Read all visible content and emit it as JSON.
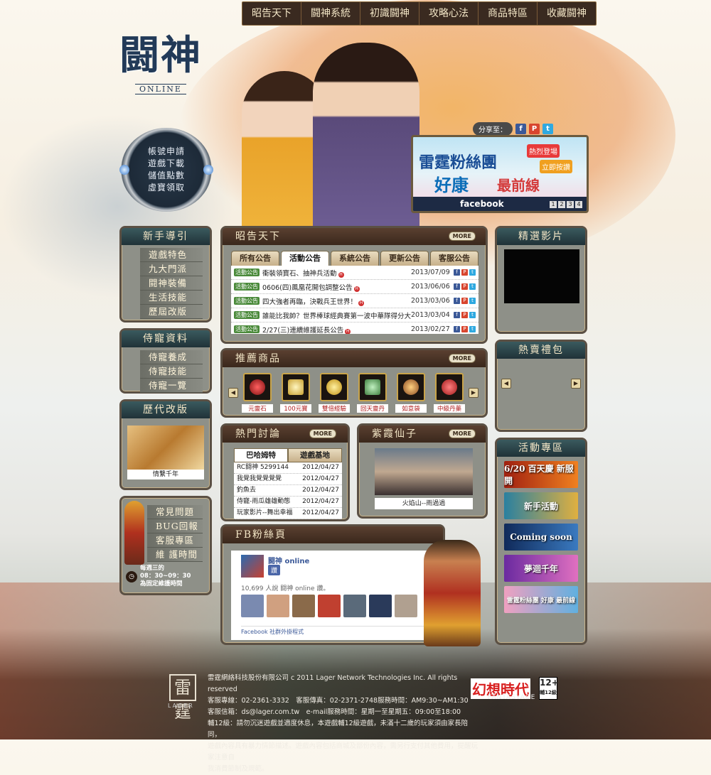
{
  "nav": [
    "昭告天下",
    "闘神系統",
    "初識闘神",
    "攻略心法",
    "商品特區",
    "收藏闘神"
  ],
  "logo": {
    "title": "闘神",
    "sub": "ONLINE"
  },
  "circle_menu": [
    "帳號申請",
    "遊戲下載",
    "儲值點數",
    "虛寶領取"
  ],
  "share": {
    "label": "分享至："
  },
  "fb_banner": {
    "line1": "雷霆粉絲團",
    "line2": "好康",
    "line3": "最前線",
    "tag1": "熱烈登場",
    "tag2": "立即按讚",
    "fb": "facebook",
    "pages": [
      "1",
      "2",
      "3",
      "4"
    ]
  },
  "newbie": {
    "title": "新手導引",
    "items": [
      "遊戲特色",
      "九大門派",
      "闘神裝備",
      "生活技能",
      "歷屆改版"
    ]
  },
  "pet": {
    "title": "侍寵資料",
    "items": [
      "侍寵養成",
      "侍寵技能",
      "侍寵一覽"
    ]
  },
  "history": {
    "title": "歷代改版",
    "caption": "情繫千年"
  },
  "service": {
    "items": [
      "常見問題",
      "BUG回報",
      "客服專區",
      "維 護時間"
    ],
    "time1": "每週三的",
    "time2": "08：30~09：30",
    "time3": "為固定維護時間"
  },
  "news": {
    "title": "昭告天下",
    "more": "MORE",
    "tabs": [
      "所有公告",
      "活動公告",
      "系統公告",
      "更新公告",
      "客服公告"
    ],
    "rows": [
      {
        "badge": "活動公告",
        "title": "衝裝領寶石、抽神兵活動",
        "date": "2013/07/09"
      },
      {
        "badge": "活動公告",
        "title": "0606(四)鳳凰花開包調整公告",
        "date": "2013/06/06"
      },
      {
        "badge": "活動公告",
        "title": "四大強者再臨，決戰兵王世界！",
        "date": "2013/03/06"
      },
      {
        "badge": "活動公告",
        "title": "誰能比我帥？世界棒球經典賽第一波中華隊得分大預測",
        "date": "2013/03/04"
      },
      {
        "badge": "活動公告",
        "title": "2/27(三)連續維護延長公告",
        "date": "2013/02/27"
      }
    ]
  },
  "products": {
    "title": "推薦商品",
    "more": "MORE",
    "items": [
      "元靈石",
      "100元寶",
      "雙倍經驗",
      "回天靈丹",
      "如意袋",
      "中級丹藥"
    ]
  },
  "discuss": {
    "title": "熱門討論",
    "more": "MORE",
    "tabs": [
      "巴哈姆特",
      "遊戲基地"
    ],
    "rows": [
      {
        "t": "RC闘神 5299144",
        "d": "2012/04/27"
      },
      {
        "t": "我覺我覺覺覺覺",
        "d": "2012/04/27"
      },
      {
        "t": "釣魚去",
        "d": "2012/04/27"
      },
      {
        "t": "侍寵-雨瓜雄雄動態",
        "d": "2012/04/27"
      },
      {
        "t": "玩家影片--舞出幸福",
        "d": "2012/04/27"
      }
    ]
  },
  "fairy": {
    "title": "紫霞仙子",
    "more": "MORE",
    "caption": "火焰山--雨過過"
  },
  "fbpage": {
    "title": "FB粉絲頁",
    "name": "闘神 online",
    "like": "讚",
    "count": "10,699 人說 闘神 online 讚。",
    "plugin": "Facebook 社群外掛程式"
  },
  "video": {
    "title": "精選影片"
  },
  "hotpack": {
    "title": "熱賣禮包"
  },
  "events": {
    "title": "活動專區",
    "items": [
      "6/20 百天慶 新服開",
      "新手活動",
      "Coming soon",
      "夢迴千年",
      "雷霆粉絲團 好康 最前線"
    ]
  },
  "footer": {
    "logo": "雷霆",
    "logo_sub": "LAGER",
    "lines": [
      "雷霆網絡科技股份有限公司 c 2011 Lager Network Technologies Inc. All rights reserved",
      "客服專線：02-2361-3332　客服傳真：02-2371-2748服務時間：AM9:30~AM1:30",
      "客服信箱：ds@lager.com.tw　e-mail服務時間：星期一至星期五：09:00至18:00",
      "輔12級：請勿沉迷遊戲並適度休息，本遊戲輔12級遊戲，未滿十二歲的玩家須由家長陪同，",
      "遊戲內容具有暴力情節描述。遊戲內容包括商城及部份內容，需另行支付其他費用，提醒玩家注意自",
      "我消費節制及規範。"
    ],
    "brand": "幻想時代",
    "brand_sub": "FANTASYAGE",
    "rating": "12+",
    "rating_sub": "輔12級"
  },
  "colors": {
    "panel": "#8e9088",
    "border": "#5b5044",
    "title_bg": "#203238",
    "gold": "#c9a44a"
  }
}
